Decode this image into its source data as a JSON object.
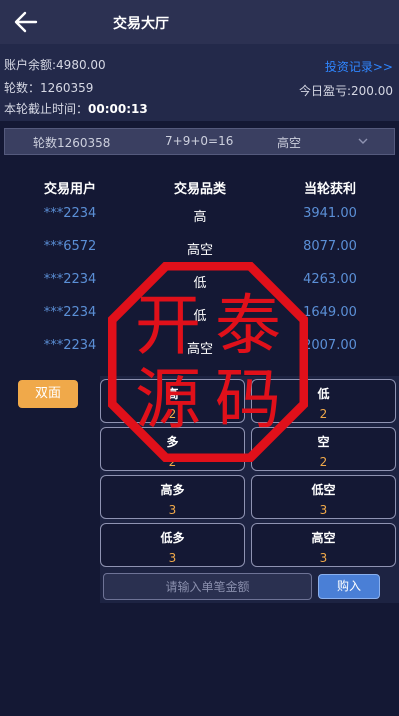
{
  "header": {
    "title": "交易大厅",
    "back_icon": "arrow-left-icon"
  },
  "account": {
    "balance_text": "账户余额:4980.00",
    "round_text": "轮数：1260359",
    "countdown_label": "本轮截止时间：",
    "countdown_value": "00:00:13",
    "records_link": "投资记录>>",
    "today_profit": "今日盈亏:200.00"
  },
  "history": {
    "round": "轮数1260358",
    "formula": "7+9+0=16",
    "result": "高空",
    "expand_icon": "chevron-down-icon"
  },
  "table": {
    "headers": [
      "交易用户",
      "交易品类",
      "当轮获利"
    ],
    "rows": [
      {
        "user": "***2234",
        "type": "高",
        "profit": "3941.00"
      },
      {
        "user": "***6572",
        "type": "高空",
        "profit": "8077.00"
      },
      {
        "user": "***2234",
        "type": "低",
        "profit": "4263.00"
      },
      {
        "user": "***2234",
        "type": "低",
        "profit": "1649.00"
      },
      {
        "user": "***2234",
        "type": "高空",
        "profit": "2007.00"
      }
    ]
  },
  "side_button": "双面",
  "bets": [
    {
      "name": "高",
      "odds": "2"
    },
    {
      "name": "低",
      "odds": "2"
    },
    {
      "name": "多",
      "odds": "2"
    },
    {
      "name": "空",
      "odds": "2"
    },
    {
      "name": "高多",
      "odds": "3"
    },
    {
      "name": "低空",
      "odds": "3"
    },
    {
      "name": "低多",
      "odds": "3"
    },
    {
      "name": "高空",
      "odds": "3"
    }
  ],
  "order": {
    "amount_placeholder": "请输入单笔金额",
    "buy_label": "购入"
  },
  "watermark": {
    "text": [
      "开",
      "泰",
      "源",
      "码"
    ],
    "color": "#e0101a"
  },
  "colors": {
    "background": "#141834",
    "accent_orange": "#f0a94a",
    "link_blue": "#2f86ff",
    "value_blue": "#5b8fd6"
  }
}
